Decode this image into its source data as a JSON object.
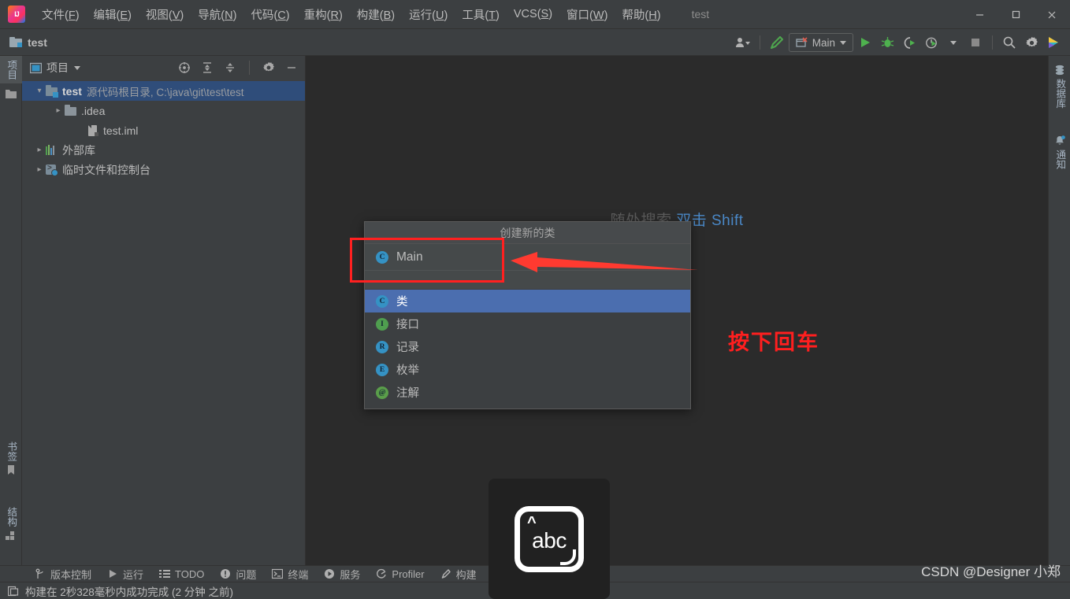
{
  "window": {
    "app_title": "test",
    "minimize_label": "—",
    "maximize_label": "□",
    "close_label": "✕"
  },
  "menu": {
    "items": [
      {
        "label": "文件",
        "mnemonic": "F"
      },
      {
        "label": "编辑",
        "mnemonic": "E"
      },
      {
        "label": "视图",
        "mnemonic": "V"
      },
      {
        "label": "导航",
        "mnemonic": "N"
      },
      {
        "label": "代码",
        "mnemonic": "C"
      },
      {
        "label": "重构",
        "mnemonic": "R"
      },
      {
        "label": "构建",
        "mnemonic": "B"
      },
      {
        "label": "运行",
        "mnemonic": "U"
      },
      {
        "label": "工具",
        "mnemonic": "T"
      },
      {
        "label": "VCS",
        "mnemonic": "S"
      },
      {
        "label": "窗口",
        "mnemonic": "W"
      },
      {
        "label": "帮助",
        "mnemonic": "H"
      }
    ]
  },
  "toolbar": {
    "project_name": "test",
    "run_config": "Main",
    "buttons": [
      {
        "name": "account-icon",
        "label": ""
      },
      {
        "name": "build-hammer-icon",
        "label": ""
      },
      {
        "name": "run-icon",
        "label": ""
      },
      {
        "name": "debug-icon",
        "label": ""
      },
      {
        "name": "run-with-coverage-icon",
        "label": ""
      },
      {
        "name": "profiler-icon",
        "label": ""
      },
      {
        "name": "stop-icon",
        "label": ""
      },
      {
        "name": "search-icon",
        "label": ""
      },
      {
        "name": "settings-gear-icon",
        "label": ""
      },
      {
        "name": "toolbox-icon",
        "label": ""
      }
    ]
  },
  "left_strip": {
    "top_items": [
      {
        "label": "项目",
        "icon": "project-icon",
        "selected": true
      },
      {
        "label": "",
        "icon": "folder-icon",
        "selected": false
      }
    ],
    "bottom_items": [
      {
        "label": "书签",
        "icon": "bookmark-icon"
      },
      {
        "label": "结构",
        "icon": "structure-icon"
      }
    ]
  },
  "right_strip": {
    "items": [
      {
        "label": "数据库",
        "icon": "database-icon"
      },
      {
        "label": "通知",
        "icon": "notification-bell-icon"
      }
    ]
  },
  "project_window": {
    "title": "项目",
    "header_buttons": [
      "locate-icon",
      "expand-all-icon",
      "collapse-all-icon",
      "settings-gear-icon",
      "hide-icon"
    ],
    "tree": [
      {
        "label": "test",
        "sublabel": "源代码根目录, C:\\java\\git\\test\\test",
        "icon": "source-root-folder-icon",
        "expanded": true,
        "selected": true,
        "indent": 0
      },
      {
        "label": ".idea",
        "sublabel": "",
        "icon": "folder-icon",
        "expanded": false,
        "selected": false,
        "indent": 1
      },
      {
        "label": "test.iml",
        "sublabel": "",
        "icon": "iml-file-icon",
        "expanded": null,
        "selected": false,
        "indent": 1
      },
      {
        "label": "外部库",
        "sublabel": "",
        "icon": "library-icon",
        "expanded": false,
        "selected": false,
        "indent": 0
      },
      {
        "label": "临时文件和控制台",
        "sublabel": "",
        "icon": "scratches-icon",
        "expanded": false,
        "selected": false,
        "indent": 0
      }
    ]
  },
  "editor": {
    "hint_prefix": "随处搜索",
    "hint_shortcut": "双击 Shift",
    "annotation": "按下回车"
  },
  "popup": {
    "title": "创建新的类",
    "name_value": "Main",
    "name_badge": "C",
    "options": [
      {
        "label": "类",
        "badge": "C",
        "kind": "c",
        "selected": true
      },
      {
        "label": "接口",
        "badge": "I",
        "kind": "i",
        "selected": false
      },
      {
        "label": "记录",
        "badge": "R",
        "kind": "r",
        "selected": false
      },
      {
        "label": "枚举",
        "badge": "E",
        "kind": "e",
        "selected": false
      },
      {
        "label": "注解",
        "badge": "@",
        "kind": "a",
        "selected": false
      }
    ]
  },
  "ime_overlay": {
    "text": "abc",
    "shift_glyph": "^"
  },
  "bottom_bar": {
    "items": [
      {
        "label": "版本控制",
        "icon": "vcs-branch-icon"
      },
      {
        "label": "运行",
        "icon": "run-icon"
      },
      {
        "label": "TODO",
        "icon": "todo-list-icon"
      },
      {
        "label": "问题",
        "icon": "problems-icon"
      },
      {
        "label": "终端",
        "icon": "terminal-icon"
      },
      {
        "label": "服务",
        "icon": "services-icon"
      },
      {
        "label": "Profiler",
        "icon": "profiler-icon"
      },
      {
        "label": "构建",
        "icon": "build-hammer-icon"
      }
    ]
  },
  "status_bar": {
    "message": "构建在 2秒328毫秒内成功完成 (2 分钟 之前)",
    "icon": "event-log-icon"
  },
  "watermark": {
    "text": "CSDN @Designer 小郑"
  },
  "colors": {
    "bg_panel": "#3c3f41",
    "bg_editor": "#2b2b2b",
    "accent_selection": "#4b6eaf",
    "tree_selection": "#2f4d7a",
    "annotation_red": "#ff1f1f",
    "link_blue": "#4a88c7"
  }
}
